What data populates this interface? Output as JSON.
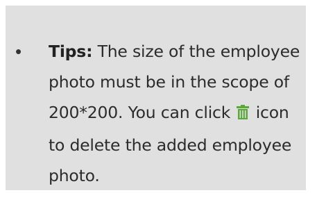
{
  "tip": {
    "label": "Tips:",
    "text_before_icon": " The size of  the employee photo must be in the scope of 200*200. You can click ",
    "icon": "trash-icon",
    "icon_color": "#5ba83a",
    "text_after_icon": " icon to delete the added employee photo."
  },
  "colors": {
    "panel_background": "#e0e0e0",
    "text": "#2b2b2b"
  }
}
